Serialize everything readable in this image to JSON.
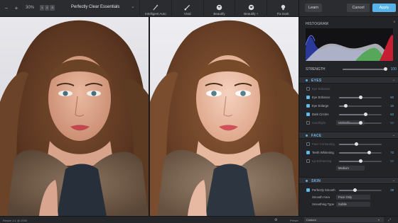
{
  "toolbar": {
    "zoom": "30%",
    "view_modes": [
      "1",
      "2",
      "3"
    ],
    "preset_title": "Perfectly Clear Essentials",
    "presets": [
      {
        "label": "Intelligent Auto",
        "icon": "magic-wand-icon"
      },
      {
        "label": "Vivid",
        "icon": "brush-icon"
      },
      {
        "label": "Beautify",
        "icon": "face-icon"
      },
      {
        "label": "Beautify +",
        "icon": "face-plus-icon"
      },
      {
        "label": "Fix Dark",
        "icon": "lightbulb-icon"
      }
    ]
  },
  "header": {
    "learn_label": "Learn",
    "cancel_label": "Cancel",
    "apply_label": "Apply"
  },
  "histogram": {
    "title": "HISTOGRAM",
    "colors": {
      "red": "#d6263b",
      "green": "#4fb04b",
      "blue": "#3b5bd6",
      "luma": "#c8ccd2"
    }
  },
  "strength": {
    "label": "STRENGTH",
    "value": "100",
    "fraction": 1.0
  },
  "sections": {
    "eyes": {
      "title": "EYES",
      "rows": [
        {
          "label": "Eye Enhance",
          "value": "",
          "enabled": false,
          "fraction": null
        },
        {
          "label": "Eye Enhance",
          "value": "50",
          "enabled": true,
          "fraction": 0.5
        },
        {
          "label": "Eye Enlarge",
          "value": "15",
          "enabled": true,
          "fraction": 0.15
        },
        {
          "label": "Dark Circles",
          "value": "63",
          "enabled": true,
          "fraction": 0.63
        },
        {
          "label": "Catchlight",
          "value": "50",
          "enabled": false,
          "fraction": 0.5
        }
      ],
      "select_value": "Umbrella"
    },
    "face": {
      "title": "FACE",
      "rows": [
        {
          "label": "Face Contouring",
          "value": "",
          "enabled": false,
          "fraction": 0.4
        },
        {
          "label": "Teeth Whitening",
          "value": "70",
          "enabled": true,
          "fraction": 0.7
        },
        {
          "label": "Lip Enhancing",
          "value": "50",
          "enabled": false,
          "fraction": 0.5
        }
      ],
      "select_value": "Medium"
    },
    "skin": {
      "title": "SKIN",
      "rows": [
        {
          "label": "Perfectly Smooth",
          "value": "38",
          "enabled": true,
          "fraction": 0.38
        },
        {
          "label": "Smooth Area",
          "value": "",
          "enabled": true,
          "fraction": null
        },
        {
          "label": "Smoothing Type",
          "value": "",
          "enabled": true,
          "fraction": null
        }
      ],
      "smooth_area": "Face Only",
      "smoothing_type": "Subtle"
    }
  },
  "status": {
    "image_size": "Resize 1:1 @ 2000",
    "preview_label": "Preset",
    "preview_value": "Custom"
  }
}
